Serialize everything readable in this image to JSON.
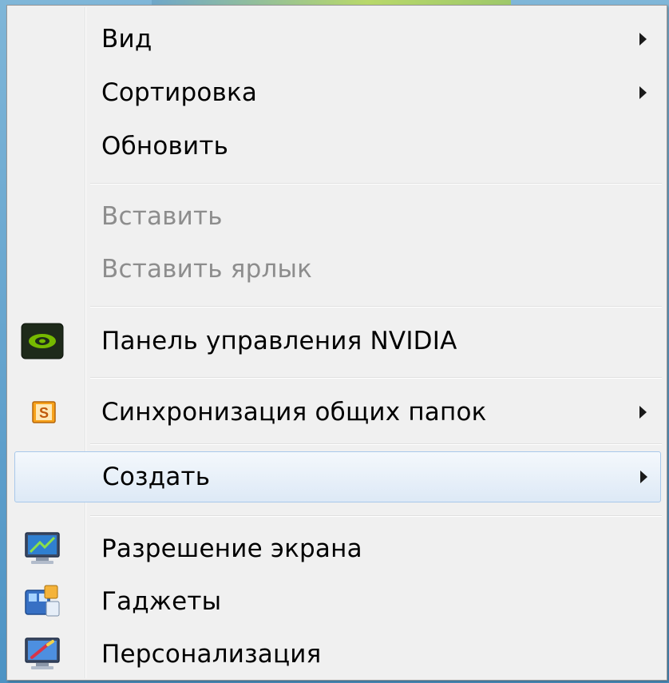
{
  "menu": {
    "items": [
      {
        "label": "Вид"
      },
      {
        "label": "Сортировка"
      },
      {
        "label": "Обновить"
      },
      {
        "label": "Вставить"
      },
      {
        "label": "Вставить ярлык"
      },
      {
        "label": "Панель управления NVIDIA",
        "icon": "nvidia-icon"
      },
      {
        "label": "Синхронизация общих папок",
        "icon": "sharepoint-s-icon",
        "icon_text": "S"
      },
      {
        "label": "Создать"
      },
      {
        "label": "Разрешение экрана",
        "icon": "screen-resolution-icon"
      },
      {
        "label": "Гаджеты",
        "icon": "gadgets-icon"
      },
      {
        "label": "Персонализация",
        "icon": "personalization-icon"
      }
    ]
  },
  "colors": {
    "menu_background": "#f0f0f0",
    "disabled_text": "#8d8d8d",
    "hover_border": "#a8c8ea",
    "nvidia_green": "#76b900"
  }
}
